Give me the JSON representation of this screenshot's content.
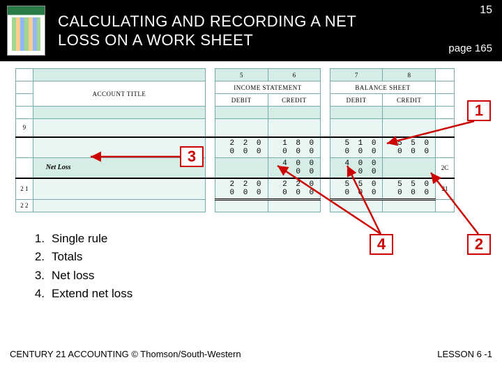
{
  "header": {
    "slide_number": "15",
    "title_line1": "CALCULATING AND RECORDING A NET",
    "title_line2": "LOSS ON A WORK SHEET",
    "page_ref": "page 165"
  },
  "sheet": {
    "col_nums": [
      "5",
      "6",
      "7",
      "8"
    ],
    "section_headers": [
      "ACCOUNT TITLE",
      "INCOME STATEMENT",
      "BALANCE SHEET"
    ],
    "sub_headers": [
      "DEBIT",
      "CREDIT",
      "DEBIT",
      "CREDIT"
    ],
    "rows": [
      {
        "left_num": "9",
        "title": "",
        "d1": "",
        "c1": "",
        "d2": "",
        "c2": "",
        "right_num": ""
      },
      {
        "left_num": "",
        "title": "",
        "d1": "2 2 0 0 0 0",
        "c1": "1 8 0 0 0 0",
        "d2": "5 1 0 0 0 0",
        "c2": "5 5 0 0 0 0",
        "right_num": ""
      },
      {
        "left_num": "",
        "title": "Net Loss",
        "d1": "",
        "c1": "4 0 0 0 0",
        "d2": "4 0 0 0 0",
        "c2": "",
        "right_num": "2C"
      },
      {
        "left_num": "2 1",
        "title": "",
        "d1": "2 2 0 0 0 0",
        "c1": "2 2 0 0 0 0",
        "d2": "5 5 0 0 0 0",
        "c2": "5 5 0 0 0 0",
        "right_num": "21"
      },
      {
        "left_num": "2 2",
        "title": "",
        "d1": "",
        "c1": "",
        "d2": "",
        "c2": "",
        "right_num": ""
      }
    ]
  },
  "callouts": {
    "c1": "1",
    "c2": "2",
    "c3": "3",
    "c4": "4"
  },
  "steps": [
    {
      "n": "1.",
      "t": "Single rule"
    },
    {
      "n": "2.",
      "t": "Totals"
    },
    {
      "n": "3.",
      "t": "Net loss"
    },
    {
      "n": "4.",
      "t": "Extend net loss"
    }
  ],
  "footer": {
    "left": "CENTURY 21 ACCOUNTING © Thomson/South-Western",
    "right": "LESSON  6 -1"
  }
}
